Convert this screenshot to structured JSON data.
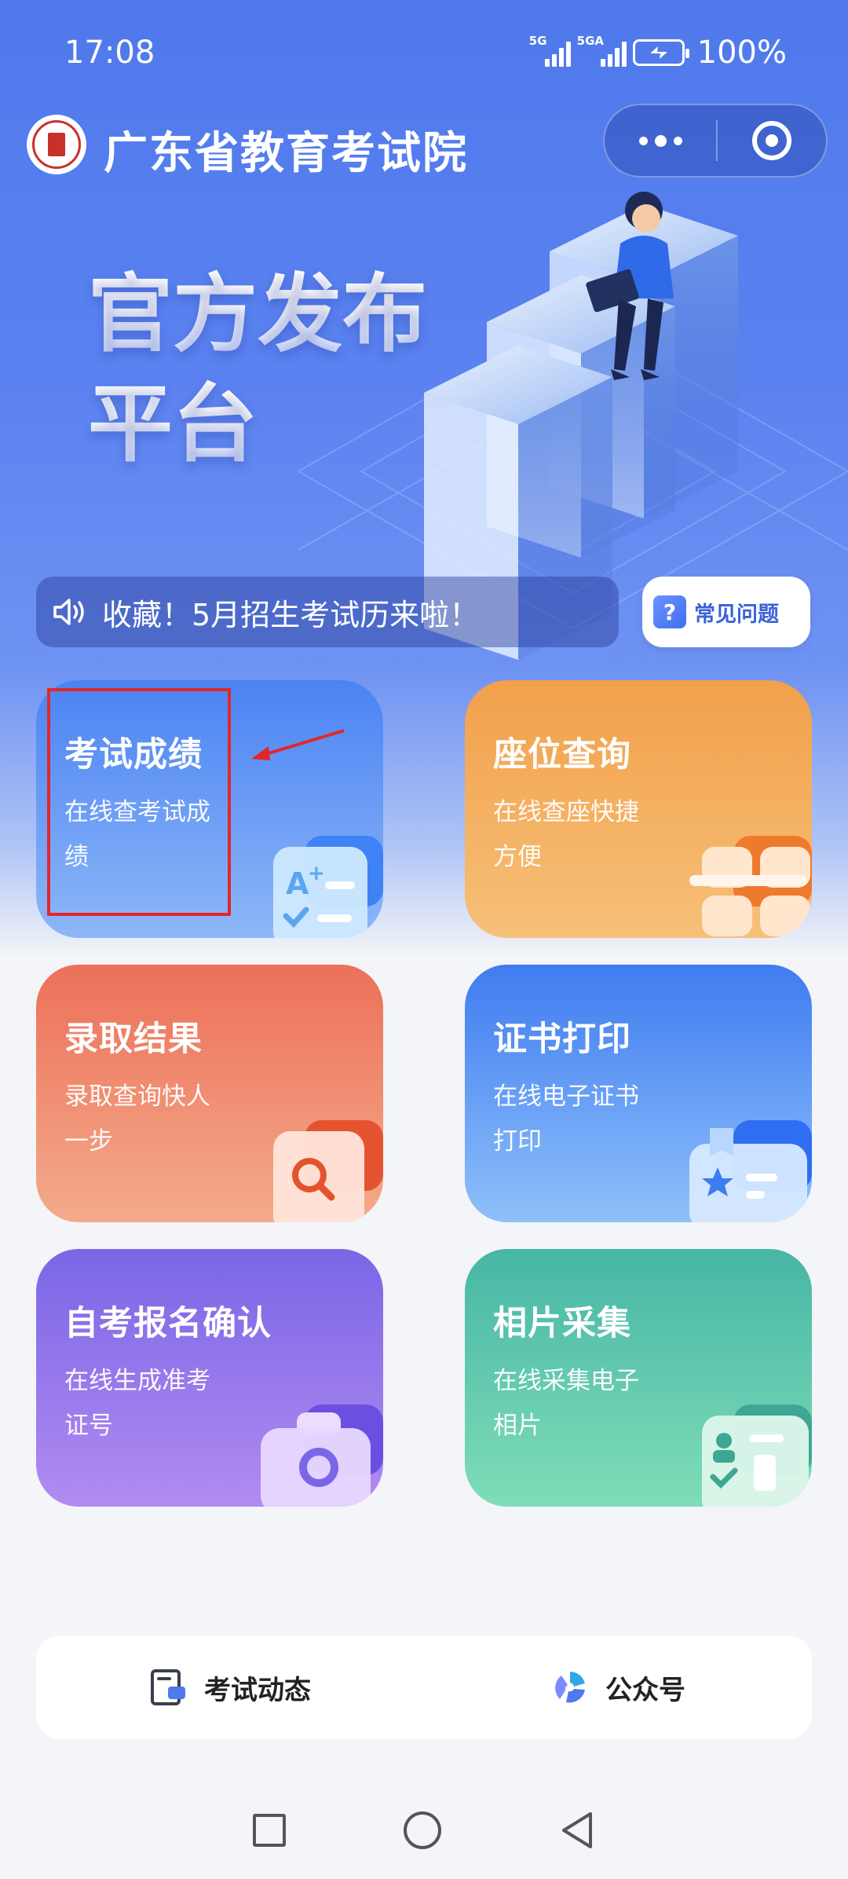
{
  "status_bar": {
    "time": "17:08",
    "signal1": "5G",
    "signal2": "5GA",
    "battery": "100%"
  },
  "header": {
    "title": "广东省教育考试院"
  },
  "hero": {
    "slogan_line1": "官方发布",
    "slogan_line2": "平台"
  },
  "notice": {
    "text": "收藏！5月招生考试历来啦！"
  },
  "faq": {
    "icon": "?",
    "label": "常见问题"
  },
  "cards": [
    {
      "title": "考试成绩",
      "desc": "在线查考试成绩",
      "icon": "exam-score-icon"
    },
    {
      "title": "座位查询",
      "desc": "在线查座快捷方便",
      "icon": "seat-icon"
    },
    {
      "title": "录取结果",
      "desc": "录取查询快人一步",
      "icon": "search-doc-icon"
    },
    {
      "title": "证书打印",
      "desc": "在线电子证书打印",
      "icon": "certificate-icon"
    },
    {
      "title": "自考报名确认",
      "desc": "在线生成准考证号",
      "icon": "camera-icon"
    },
    {
      "title": "相片采集",
      "desc": "在线采集电子相片",
      "icon": "photo-form-icon"
    }
  ],
  "bottom_bar": {
    "exam_news": "考试动态",
    "official_account": "公众号"
  },
  "colors": {
    "primary": "#4f79ec",
    "highlight": "#e3262a"
  }
}
